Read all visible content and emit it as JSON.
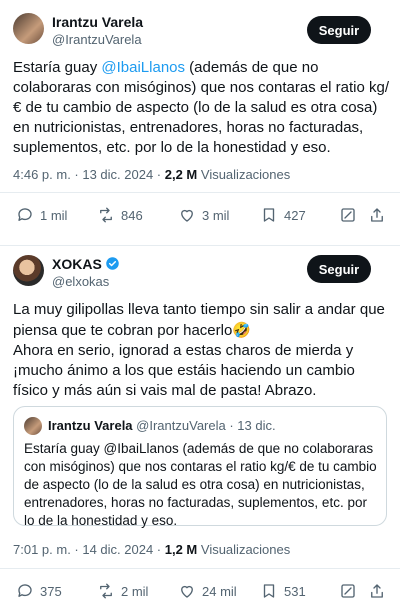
{
  "tweet1": {
    "name": "Irantzu Varela",
    "handle": "@IrantzuVarela",
    "follow_label": "Seguir",
    "text_before": "Estaría guay ",
    "mention": "@IbaiLlanos",
    "text_after": " (además de que no colaboraras con misóginos) que nos contaras el ratio kg/€ de tu cambio de aspecto (lo de la salud es otra cosa) en nutricionistas, entrenadores, horas no facturadas, suplementos, etc. por lo de la honestidad y eso.",
    "time": "4:46 p. m. · 13 dic. 2024 · ",
    "views_count": "2,2 M",
    "views_label": " Visualizaciones",
    "replies": "1 mil",
    "reposts": "846",
    "likes": "3 mil",
    "bookmarks": "427"
  },
  "tweet2": {
    "name": "XOKAS",
    "handle": "@elxokas",
    "follow_label": "Seguir",
    "text_line1": "La muy gilipollas lleva tanto tiempo sin salir a andar que piensa que te cobran por hacerlo",
    "emoji": "🤣",
    "text_line2": "Ahora en serio, ignorad a estas charos de mierda y ¡mucho ánimo a los que estáis haciendo un cambio físico y más aún si vais mal de pasta! Abrazo.",
    "quote": {
      "name": "Irantzu Varela",
      "handle": "@IrantzuVarela · 13 dic.",
      "text": "Estaría guay @IbaiLlanos (además de que no colaboraras con misóginos) que nos contaras el ratio kg/€ de tu cambio de aspecto (lo de la salud es otra cosa) en nutricionistas, entrenadores, horas no facturadas, suplementos, etc. por lo de la honestidad y eso."
    },
    "time": "7:01 p. m. · 14 dic. 2024 · ",
    "views_count": "1,2 M",
    "views_label": " Visualizaciones",
    "replies": "375",
    "reposts": "2 mil",
    "likes": "24 mil",
    "bookmarks": "531"
  },
  "colors": {
    "accent": "#1d9bf0",
    "text": "#0f1419",
    "muted": "#536471",
    "button": "#0f1419"
  },
  "icons": [
    "reply-icon",
    "repost-icon",
    "like-icon",
    "bookmark-icon",
    "share-icon",
    "verified-icon"
  ]
}
